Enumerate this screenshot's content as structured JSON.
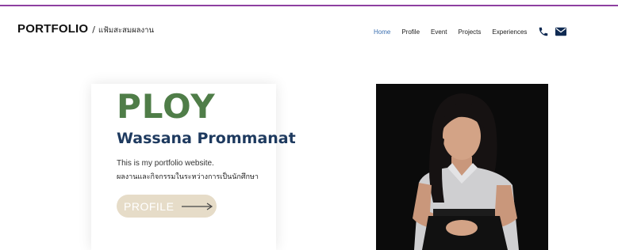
{
  "brand": {
    "title": "PORTFOLIO",
    "separator": "/",
    "subtitle": "แฟ้มสะสมผลงาน"
  },
  "nav": {
    "items": [
      "Home",
      "Profile",
      "Event",
      "Projects",
      "Experiences"
    ],
    "active_index": 0,
    "icons": [
      "phone-icon",
      "mail-icon"
    ]
  },
  "hero": {
    "nickname": "PLOY",
    "full_name": "Wassana Prommanat",
    "intro_en": "This is my portfolio website.",
    "intro_th": "ผลงานและกิจกรรมในระหว่างการเป็นนักศึกษา",
    "cta_label": "PROFILE"
  },
  "colors": {
    "accent_line": "#8e3fa0",
    "nickname": "#4f7d48",
    "full_name": "#1e3a5f",
    "nav_active": "#3b6fb0",
    "button_bg": "#e6dcc8",
    "icon": "#0f2a52"
  }
}
